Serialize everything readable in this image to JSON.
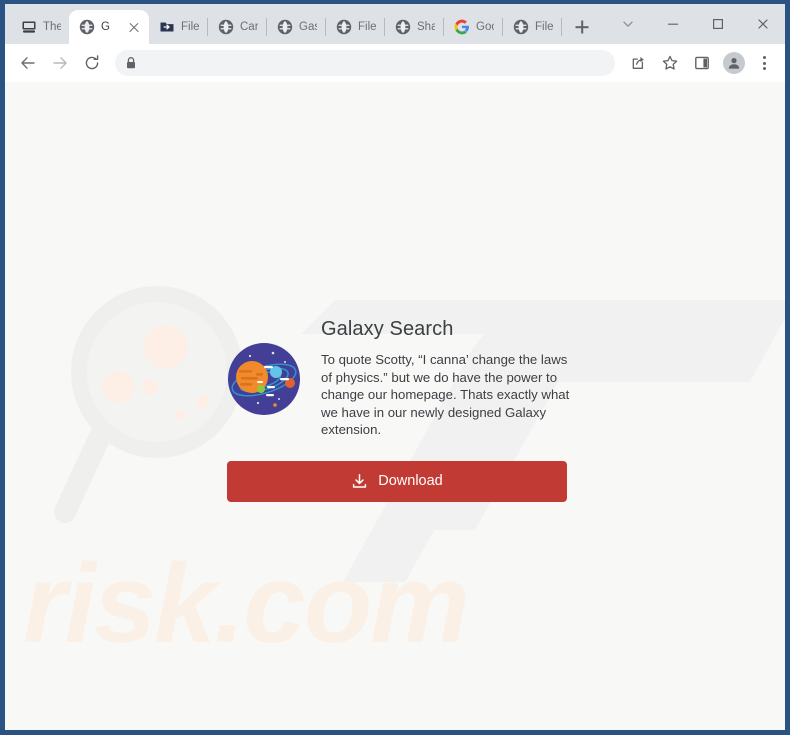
{
  "window": {
    "frame_color": "#2a5282",
    "controls": [
      {
        "name": "tab-search",
        "icon": "chevron-down-icon"
      },
      {
        "name": "minimize",
        "icon": "minimize-icon"
      },
      {
        "name": "maximize",
        "icon": "maximize-icon"
      },
      {
        "name": "close",
        "icon": "close-icon"
      }
    ]
  },
  "tabs": [
    {
      "label": "The ",
      "favicon": "computer-icon",
      "active": false
    },
    {
      "label": "G",
      "favicon": "globe-icon",
      "active": true
    },
    {
      "label": "FileT",
      "favicon": "file-share-icon",
      "active": false
    },
    {
      "label": "Car ",
      "favicon": "globe-icon",
      "active": false
    },
    {
      "label": "Gast",
      "favicon": "globe-icon",
      "active": false
    },
    {
      "label": "File ",
      "favicon": "globe-icon",
      "active": false
    },
    {
      "label": "Shap",
      "favicon": "globe-icon",
      "active": false
    },
    {
      "label": "Goog",
      "favicon": "google-g-icon",
      "active": false
    },
    {
      "label": "File ",
      "favicon": "globe-icon",
      "active": false
    }
  ],
  "new_tab": {
    "label": "New tab",
    "icon": "plus-icon"
  },
  "toolbar": {
    "back": {
      "label": "Back",
      "icon": "arrow-left-icon",
      "enabled": true
    },
    "forward": {
      "label": "Forward",
      "icon": "arrow-right-icon",
      "enabled": false
    },
    "reload": {
      "label": "Reload",
      "icon": "reload-icon"
    },
    "address": {
      "value": "",
      "placeholder": "",
      "lock_icon": "lock-icon"
    },
    "share": {
      "label": "Share",
      "icon": "share-icon"
    },
    "bookmark": {
      "label": "Bookmark this tab",
      "icon": "star-icon"
    },
    "side_panel": {
      "label": "Side panel",
      "icon": "side-panel-icon"
    },
    "profile": {
      "label": "Profile",
      "icon": "person-icon"
    },
    "menu": {
      "label": "Customize and control",
      "icon": "three-dot-menu-icon"
    }
  },
  "page": {
    "background_color": "#f8f8f7",
    "title": "Galaxy Search",
    "description": "To quote Scotty, “I canna’ change the laws of physics.” but we do have the power to change our homepage. Thats exactly what we have in our newly designed Galaxy extension.",
    "download_button": {
      "label": "Download",
      "icon": "download-icon",
      "color": "#c13a33",
      "text_color": "#ffffff"
    },
    "logo_icon": "solar-system-planet-icon",
    "watermarks": {
      "magnifier": {
        "icon": "magnifier-icon",
        "color": "#f1f1f0"
      },
      "brand_mark": {
        "icon": "slanted-brand-mark",
        "color": "#f1f1f1"
      },
      "site_text": {
        "text": "risk.com",
        "color": "#fbf0e8"
      }
    }
  }
}
